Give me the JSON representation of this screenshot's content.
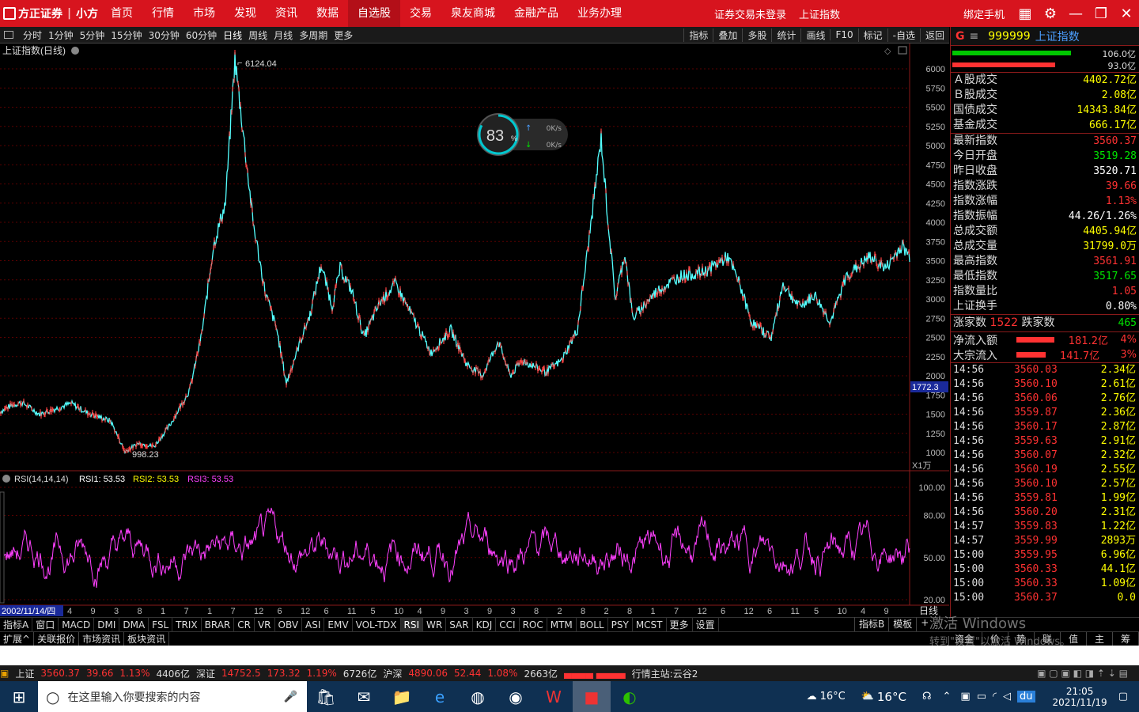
{
  "topbar": {
    "brand": "方正证券",
    "app": "小方",
    "menu": [
      "首页",
      "行情",
      "市场",
      "发现",
      "资讯",
      "数据",
      "自选股",
      "交易",
      "泉友商城",
      "金融产品",
      "业务办理"
    ],
    "active_menu": "自选股",
    "status": "证券交易未登录",
    "index_name": "上证指数",
    "bind": "绑定手机"
  },
  "toolbar": {
    "periods": [
      "分时",
      "1分钟",
      "5分钟",
      "15分钟",
      "30分钟",
      "60分钟",
      "日线",
      "周线",
      "月线",
      "多周期",
      "更多"
    ],
    "active": "日线",
    "right": [
      "指标",
      "叠加",
      "多股",
      "统计",
      "画线",
      "F10",
      "标记",
      "-自选",
      "返回"
    ]
  },
  "chart": {
    "title": "上证指数(日线)",
    "high_label": "6124.04",
    "low_label": "998.23",
    "cursor_price": "1772.3",
    "unit_label": "X1万",
    "y_ticks": [
      "6000",
      "5750",
      "5500",
      "5250",
      "5000",
      "4750",
      "4500",
      "4250",
      "4000",
      "3750",
      "3500",
      "3250",
      "3000",
      "2750",
      "2500",
      "2250",
      "2000",
      "1750",
      "1500",
      "1250",
      "1000"
    ],
    "rsi_title": "RSI(14,14,14)",
    "rsi1": "RSI1: 53.53",
    "rsi2": "RSI2: 53.53",
    "rsi3": "RSI3: 53.53",
    "rsi_ticks": [
      "100.00",
      "80.00",
      "50.00",
      "20.00"
    ],
    "date_label": "2002/11/14/四",
    "x_ticks": [
      "4",
      "9",
      "3",
      "8",
      "1",
      "7",
      "1",
      "7",
      "12",
      "6",
      "12",
      "6",
      "11",
      "5",
      "10",
      "4",
      "9",
      "3",
      "9",
      "3",
      "8",
      "2",
      "8",
      "2",
      "8",
      "1",
      "7",
      "12",
      "6",
      "12",
      "6",
      "11",
      "5",
      "10",
      "4",
      "9"
    ],
    "period_label": "日线"
  },
  "net": {
    "pct": "83",
    "unit": "%",
    "up": "0K/s",
    "down": "0K/s"
  },
  "chart_data": {
    "type": "line",
    "title": "上证指数(日线)",
    "y_range": [
      998.23,
      6124.04
    ],
    "anchor_points": [
      [
        0,
        1530
      ],
      [
        15,
        1620
      ],
      [
        28,
        1650
      ],
      [
        50,
        1500
      ],
      [
        70,
        1570
      ],
      [
        90,
        1640
      ],
      [
        110,
        1520
      ],
      [
        140,
        1410
      ],
      [
        158,
        1010
      ],
      [
        175,
        1120
      ],
      [
        195,
        1080
      ],
      [
        215,
        1360
      ],
      [
        240,
        1820
      ],
      [
        255,
        2540
      ],
      [
        270,
        3700
      ],
      [
        285,
        4250
      ],
      [
        297,
        6124
      ],
      [
        305,
        5400
      ],
      [
        320,
        4000
      ],
      [
        335,
        3100
      ],
      [
        350,
        2600
      ],
      [
        362,
        1900
      ],
      [
        378,
        2400
      ],
      [
        392,
        2800
      ],
      [
        406,
        3450
      ],
      [
        420,
        2900
      ],
      [
        430,
        3400
      ],
      [
        445,
        3100
      ],
      [
        460,
        2500
      ],
      [
        480,
        2950
      ],
      [
        500,
        3200
      ],
      [
        520,
        2800
      ],
      [
        545,
        2300
      ],
      [
        570,
        2600
      ],
      [
        590,
        2150
      ],
      [
        610,
        2000
      ],
      [
        630,
        2450
      ],
      [
        645,
        2000
      ],
      [
        660,
        2200
      ],
      [
        690,
        2050
      ],
      [
        710,
        2200
      ],
      [
        730,
        2600
      ],
      [
        745,
        3800
      ],
      [
        760,
        5100
      ],
      [
        768,
        4100
      ],
      [
        778,
        3000
      ],
      [
        790,
        3600
      ],
      [
        800,
        2750
      ],
      [
        830,
        3100
      ],
      [
        860,
        3300
      ],
      [
        890,
        3350
      ],
      [
        920,
        3550
      ],
      [
        935,
        3200
      ],
      [
        950,
        2700
      ],
      [
        975,
        2500
      ],
      [
        990,
        3200
      ],
      [
        1010,
        2900
      ],
      [
        1030,
        3050
      ],
      [
        1050,
        2700
      ],
      [
        1070,
        3300
      ],
      [
        1100,
        3550
      ],
      [
        1120,
        3400
      ],
      [
        1140,
        3700
      ],
      [
        1150,
        3560
      ]
    ],
    "rsi_values": [
      53.53
    ]
  },
  "rpanel": {
    "g": "G",
    "code": "999999",
    "name": "上证指数",
    "bar1": "106.0亿",
    "bar2": "93.0亿",
    "vol": [
      {
        "k": "Ａ股成交",
        "v": "4402.72亿",
        "c": "yel"
      },
      {
        "k": "Ｂ股成交",
        "v": "2.08亿",
        "c": "yel"
      },
      {
        "k": "国债成交",
        "v": "14343.84亿",
        "c": "yel"
      },
      {
        "k": "基金成交",
        "v": "666.17亿",
        "c": "yel"
      }
    ],
    "quote": [
      {
        "k": "最新指数",
        "v": "3560.37",
        "c": "red"
      },
      {
        "k": "今日开盘",
        "v": "3519.28",
        "c": "green"
      },
      {
        "k": "昨日收盘",
        "v": "3520.71",
        "c": "white"
      },
      {
        "k": "指数涨跌",
        "v": "39.66",
        "c": "red"
      },
      {
        "k": "指数涨幅",
        "v": "1.13%",
        "c": "red"
      },
      {
        "k": "指数振幅",
        "v": "44.26/1.26%",
        "c": "white"
      },
      {
        "k": "总成交额",
        "v": "4405.94亿",
        "c": "yel"
      },
      {
        "k": "总成交量",
        "v": "31799.0万",
        "c": "yel"
      },
      {
        "k": "最高指数",
        "v": "3561.91",
        "c": "red"
      },
      {
        "k": "最低指数",
        "v": "3517.65",
        "c": "green"
      },
      {
        "k": "指数量比",
        "v": "1.05",
        "c": "red"
      },
      {
        "k": "上证换手",
        "v": "0.80%",
        "c": "white"
      }
    ],
    "updown": {
      "up_k": "涨家数",
      "up_v": "1522",
      "dn_k": "跌家数",
      "dn_v": "465"
    },
    "flows": [
      {
        "k": "净流入额",
        "amt": "181.2亿",
        "pct": "4%",
        "fill": 0.8
      },
      {
        "k": "大宗流入",
        "amt": "141.7亿",
        "pct": "3%",
        "fill": 0.62
      }
    ],
    "ticks": [
      [
        "14:56",
        "3560.03",
        "2.34亿"
      ],
      [
        "14:56",
        "3560.10",
        "2.61亿"
      ],
      [
        "14:56",
        "3560.06",
        "2.76亿"
      ],
      [
        "14:56",
        "3559.87",
        "2.36亿"
      ],
      [
        "14:56",
        "3560.17",
        "2.87亿"
      ],
      [
        "14:56",
        "3559.63",
        "2.91亿"
      ],
      [
        "14:56",
        "3560.07",
        "2.32亿"
      ],
      [
        "14:56",
        "3560.19",
        "2.55亿"
      ],
      [
        "14:56",
        "3560.10",
        "2.57亿"
      ],
      [
        "14:56",
        "3559.81",
        "1.99亿"
      ],
      [
        "14:56",
        "3560.20",
        "2.31亿"
      ],
      [
        "14:57",
        "3559.83",
        "1.22亿"
      ],
      [
        "14:57",
        "3559.99",
        "2893万"
      ],
      [
        "15:00",
        "3559.95",
        "6.96亿"
      ],
      [
        "15:00",
        "3560.33",
        "44.1亿"
      ],
      [
        "15:00",
        "3560.33",
        "1.09亿"
      ],
      [
        "15:00",
        "3560.37",
        "0.0"
      ]
    ]
  },
  "bottom_tabs": [
    "指标A",
    "窗口",
    "MACD",
    "DMI",
    "DMA",
    "FSL",
    "TRIX",
    "BRAR",
    "CR",
    "VR",
    "OBV",
    "ASI",
    "EMV",
    "VOL-TDX",
    "RSI",
    "WR",
    "SAR",
    "KDJ",
    "CCI",
    "ROC",
    "MTM",
    "BOLL",
    "PSY",
    "MCST",
    "更多",
    "设置"
  ],
  "bottom_active": "RSI",
  "bottom_right": [
    "指标B",
    "模板",
    "+",
    "资金",
    "价",
    "势",
    "联",
    "值",
    "主",
    "筹"
  ],
  "bottom2": [
    "扩展^",
    "关联报价",
    "市场资讯",
    "板块资讯"
  ],
  "watermark": "激活 Windows",
  "watermark2": "转到\"设置\"以激活 Windows。",
  "status": [
    {
      "t": "上证",
      "c": "#ddd"
    },
    {
      "t": "3560.37",
      "c": "#ff3232"
    },
    {
      "t": "39.66",
      "c": "#ff3232"
    },
    {
      "t": "1.13%",
      "c": "#ff3232"
    },
    {
      "t": "4406亿",
      "c": "#ddd"
    },
    {
      "t": "深证",
      "c": "#ddd"
    },
    {
      "t": "14752.5",
      "c": "#ff3232"
    },
    {
      "t": "173.32",
      "c": "#ff3232"
    },
    {
      "t": "1.19%",
      "c": "#ff3232"
    },
    {
      "t": "6726亿",
      "c": "#ddd"
    },
    {
      "t": "沪深",
      "c": "#ddd"
    },
    {
      "t": "4890.06",
      "c": "#ff3232"
    },
    {
      "t": "52.44",
      "c": "#ff3232"
    },
    {
      "t": "1.08%",
      "c": "#ff3232"
    },
    {
      "t": "2663亿",
      "c": "#ddd"
    },
    {
      "t": "行情主站:云谷2",
      "c": "#ddd"
    }
  ],
  "taskbar": {
    "search": "在这里输入你要搜索的内容",
    "temp1": "16°C",
    "temp2": "16°C",
    "time": "21:05",
    "date": "2021/11/19"
  }
}
